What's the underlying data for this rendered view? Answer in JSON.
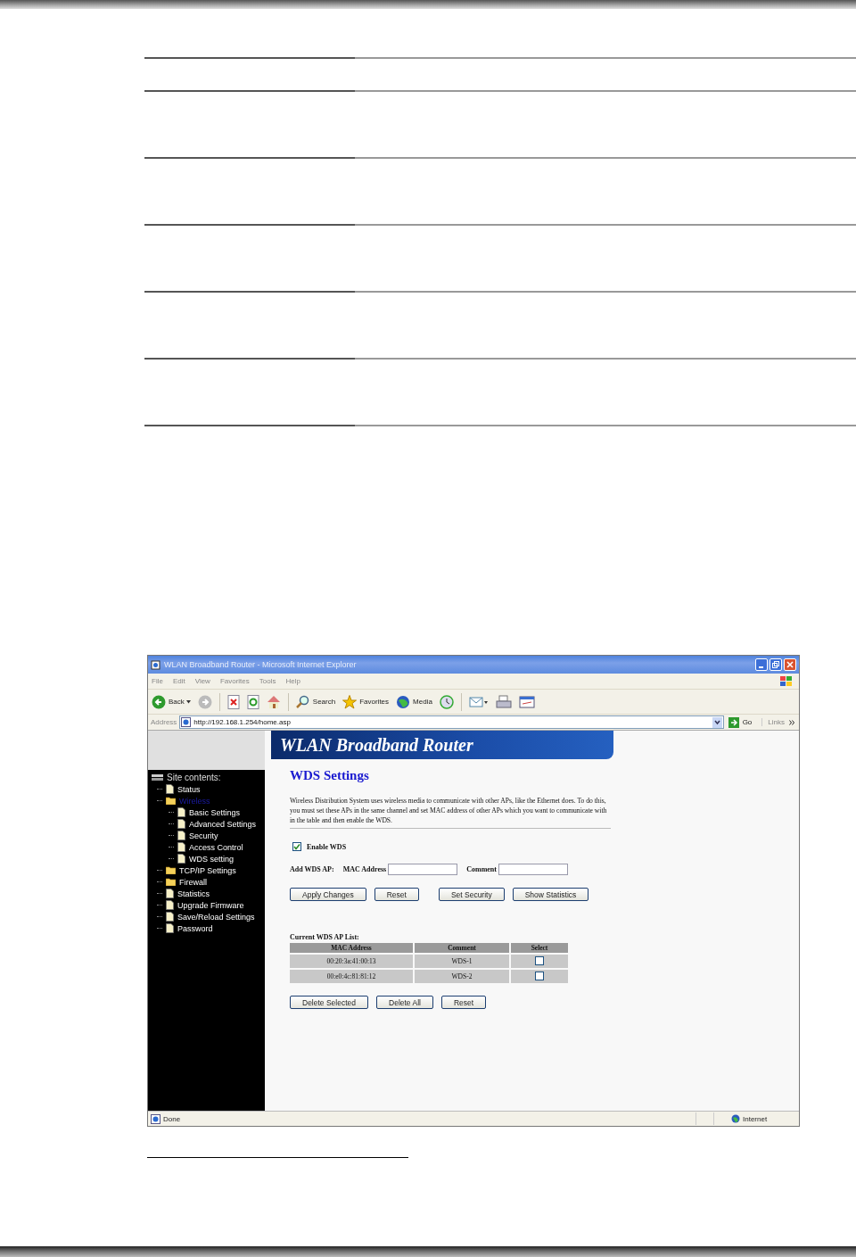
{
  "window": {
    "title": "WLAN Broadband Router - Microsoft Internet Explorer"
  },
  "menu": [
    "File",
    "Edit",
    "View",
    "Favorites",
    "Tools",
    "Help"
  ],
  "toolbar": [
    {
      "kind": "back",
      "label": "Back"
    },
    {
      "kind": "forward"
    },
    {
      "kind": "stop"
    },
    {
      "kind": "refresh"
    },
    {
      "kind": "home"
    },
    {
      "kind": "search",
      "label": "Search"
    },
    {
      "kind": "favorites",
      "label": "Favorites"
    },
    {
      "kind": "media",
      "label": "Media"
    },
    {
      "kind": "history"
    },
    {
      "kind": "mail"
    },
    {
      "kind": "print"
    },
    {
      "kind": "edit"
    }
  ],
  "address_bar": {
    "label": "Address",
    "url": "http://192.168.1.254/home.asp",
    "go": "Go",
    "links": "Links"
  },
  "banner": {
    "title": "WLAN Broadband Router"
  },
  "sidebar": {
    "header": "Site contents:",
    "items": [
      {
        "label": "Status",
        "kind": "page",
        "selected": false
      },
      {
        "label": "Wireless",
        "kind": "folder",
        "selected": true,
        "children": [
          {
            "label": "Basic Settings",
            "kind": "page",
            "selected": false
          },
          {
            "label": "Advanced Settings",
            "kind": "page",
            "selected": false
          },
          {
            "label": "Security",
            "kind": "page",
            "selected": false
          },
          {
            "label": "Access Control",
            "kind": "page",
            "selected": false
          },
          {
            "label": "WDS setting",
            "kind": "page",
            "selected": false
          }
        ]
      },
      {
        "label": "TCP/IP Settings",
        "kind": "folder",
        "selected": false
      },
      {
        "label": "Firewall",
        "kind": "folder",
        "selected": false
      },
      {
        "label": "Statistics",
        "kind": "page",
        "selected": false
      },
      {
        "label": "Upgrade Firmware",
        "kind": "page",
        "selected": false
      },
      {
        "label": "Save/Reload Settings",
        "kind": "page",
        "selected": false
      },
      {
        "label": "Password",
        "kind": "page",
        "selected": false
      }
    ]
  },
  "content": {
    "heading": "WDS Settings",
    "description": "Wireless Distribution System uses wireless media to communicate with other APs, like the Ethernet does. To do this, you must set these APs in the same channel and set MAC address of other APs which you want to communicate with in the table and then enable the WDS.",
    "enable_wds": {
      "label": "Enable WDS",
      "checked": true
    },
    "add_label": "Add WDS AP:",
    "mac_label": "MAC Address",
    "comment_label": "Comment",
    "buttons": [
      "Apply Changes",
      "Reset",
      "Set Security",
      "Show Statistics"
    ],
    "list_title": "Current WDS AP List:",
    "table": {
      "columns": [
        "MAC Address",
        "Comment",
        "Select"
      ],
      "rows": [
        {
          "mac": "00:20:3a:41:00:13",
          "comment": "WDS-1",
          "checked": false
        },
        {
          "mac": "00:e0:4c:81:81:12",
          "comment": "WDS-2",
          "checked": false
        }
      ]
    },
    "list_buttons": [
      "Delete Selected",
      "Delete All",
      "Reset"
    ]
  },
  "status_bar": {
    "text": "Done",
    "zone": "Internet"
  }
}
